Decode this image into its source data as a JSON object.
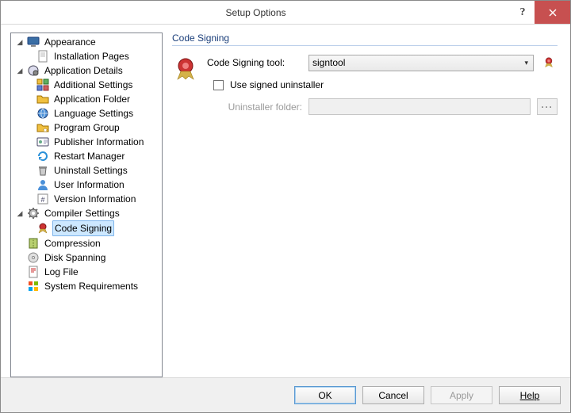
{
  "window": {
    "title": "Setup Options"
  },
  "tree": {
    "items": [
      {
        "label": "Appearance",
        "top": true,
        "icon": "monitor"
      },
      {
        "label": "Installation Pages",
        "top": false,
        "icon": "page"
      },
      {
        "label": "Application Details",
        "top": true,
        "icon": "globe-cog"
      },
      {
        "label": "Additional Settings",
        "top": false,
        "icon": "blocks"
      },
      {
        "label": "Application Folder",
        "top": false,
        "icon": "folder"
      },
      {
        "label": "Language Settings",
        "top": false,
        "icon": "globe"
      },
      {
        "label": "Program Group",
        "top": false,
        "icon": "folder-star"
      },
      {
        "label": "Publisher Information",
        "top": false,
        "icon": "vcard"
      },
      {
        "label": "Restart Manager",
        "top": false,
        "icon": "refresh"
      },
      {
        "label": "Uninstall Settings",
        "top": false,
        "icon": "trash"
      },
      {
        "label": "User Information",
        "top": false,
        "icon": "user"
      },
      {
        "label": "Version Information",
        "top": false,
        "icon": "version"
      },
      {
        "label": "Compiler Settings",
        "top": true,
        "icon": "gear"
      },
      {
        "label": "Code Signing",
        "top": false,
        "icon": "seal",
        "selected": true
      },
      {
        "label": "Compression",
        "top": true,
        "icon": "compress"
      },
      {
        "label": "Disk Spanning",
        "top": true,
        "icon": "disc"
      },
      {
        "label": "Log File",
        "top": true,
        "icon": "log"
      },
      {
        "label": "System Requirements",
        "top": true,
        "icon": "win"
      }
    ]
  },
  "content": {
    "section_title": "Code Signing",
    "tool_label": "Code Signing tool:",
    "tool_value": "signtool",
    "use_signed_label": "Use signed uninstaller",
    "use_signed_checked": false,
    "uninstaller_folder_label": "Uninstaller folder:",
    "uninstaller_folder_value": "",
    "uninstaller_folder_enabled": false,
    "browse_glyph": "···"
  },
  "buttons": {
    "ok": "OK",
    "cancel": "Cancel",
    "apply": "Apply",
    "help": "Help"
  },
  "icons": {
    "help_glyph": "?",
    "dropdown_glyph": "▾",
    "expander_open": "◢"
  }
}
